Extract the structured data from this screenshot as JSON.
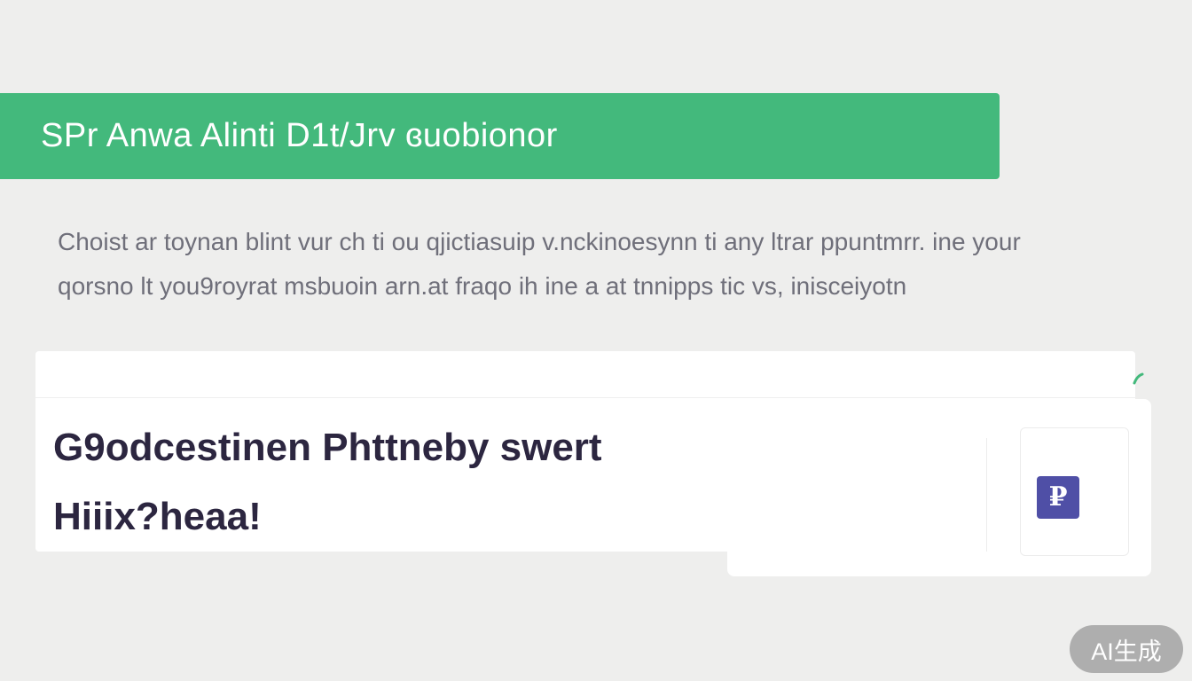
{
  "banner": {
    "title": "SPr Anwa Alinti D1t/Jrv ɞuobionor"
  },
  "description": {
    "line1": "Choist ar toynan blint vur ch ti ou qjictiasuip v.nckinoesynn ti any ltrar ppuntmrr. ine your",
    "line2": "qorsno lt you9royrat msbuoin arn.at fraqo ih ine a at tnnipps tic vs, inisceiyotn"
  },
  "card": {
    "heading_line1": "G9odcestinen Phttneby swert",
    "heading_line2": "Hiiix?heaa!"
  },
  "app_tile": {
    "icon": "app-logo-icon",
    "glyph": "₽"
  },
  "badge": {
    "label": "AI生成"
  },
  "colors": {
    "accent": "#43b97c",
    "background": "#eeeeed",
    "heading": "#2c2640",
    "icon": "#4f4fa6"
  }
}
